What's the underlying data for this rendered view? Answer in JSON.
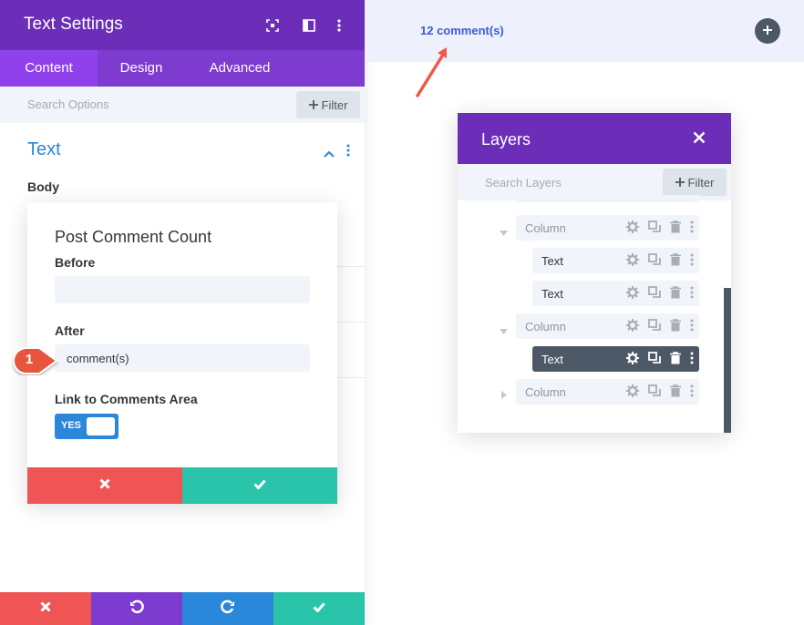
{
  "settings_panel": {
    "title": "Text Settings",
    "header_icons": [
      "fullscreen-icon",
      "split-view-icon",
      "more-icon"
    ],
    "tabs": [
      {
        "label": "Content",
        "active": true
      },
      {
        "label": "Design",
        "active": false
      },
      {
        "label": "Advanced",
        "active": false
      }
    ],
    "search_placeholder": "Search Options",
    "filter_label": "Filter",
    "section_title": "Text",
    "body_label": "Body"
  },
  "dynamic_popup": {
    "title": "Post Comment Count",
    "before_label": "Before",
    "before_value": "",
    "after_label": "After",
    "after_value": "comment(s)",
    "link_label": "Link to Comments Area",
    "toggle_text": "YES",
    "toggle_on": true
  },
  "step_badge": "1",
  "bottom_bar": {
    "buttons": [
      "close-icon",
      "undo-icon",
      "redo-icon",
      "check-icon"
    ]
  },
  "page": {
    "comment_link": "12 comment(s)"
  },
  "layers": {
    "title": "Layers",
    "search_placeholder": "Search Layers",
    "filter_label": "Filter",
    "rows": [
      {
        "label": "Column",
        "expanded": true,
        "selected": false
      },
      {
        "label": "Text",
        "selected": false
      },
      {
        "label": "Text",
        "selected": false
      },
      {
        "label": "Column",
        "expanded": true,
        "selected": false
      },
      {
        "label": "Text",
        "selected": true
      },
      {
        "label": "Column",
        "expanded": false,
        "selected": false
      }
    ]
  },
  "colors": {
    "purple_header": "#6c2eb9",
    "purple_tab": "#7d3bcf",
    "accent_blue": "#2b87da",
    "red": "#ef5555",
    "green": "#29c4a9",
    "dark_slate": "#4c5866"
  }
}
